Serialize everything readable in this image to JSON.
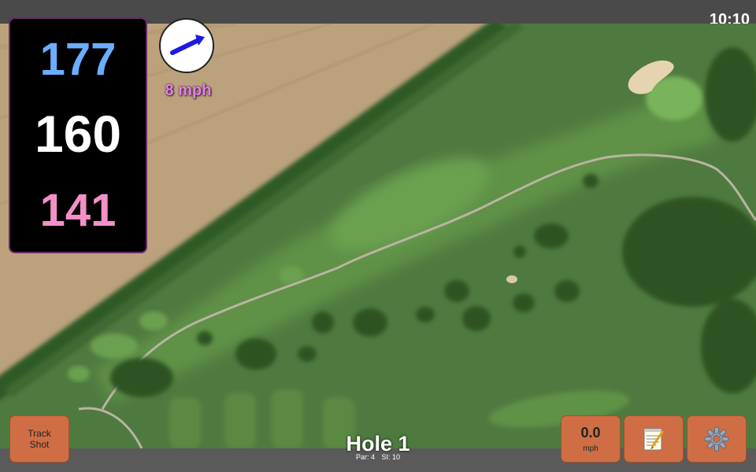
{
  "status_bar": {
    "time": "10:10"
  },
  "distances": {
    "back": "177",
    "middle": "160",
    "front": "141"
  },
  "wind": {
    "speed": "8 mph",
    "icon": "wind-direction-arrow-icon"
  },
  "hole": {
    "title": "Hole 1",
    "par": "Par: 4",
    "stroke_index": "SI: 10"
  },
  "buttons": {
    "track_shot": "Track Shot",
    "speed_value": "0.0",
    "speed_unit": "mph",
    "notes_icon": "notepad-icon",
    "settings_icon": "gear-icon"
  },
  "colors": {
    "back_distance": "#6aaeff",
    "middle_distance": "#ffffff",
    "front_distance": "#f490c8",
    "wind_text": "#e87de8",
    "button": "#cf6e45"
  }
}
